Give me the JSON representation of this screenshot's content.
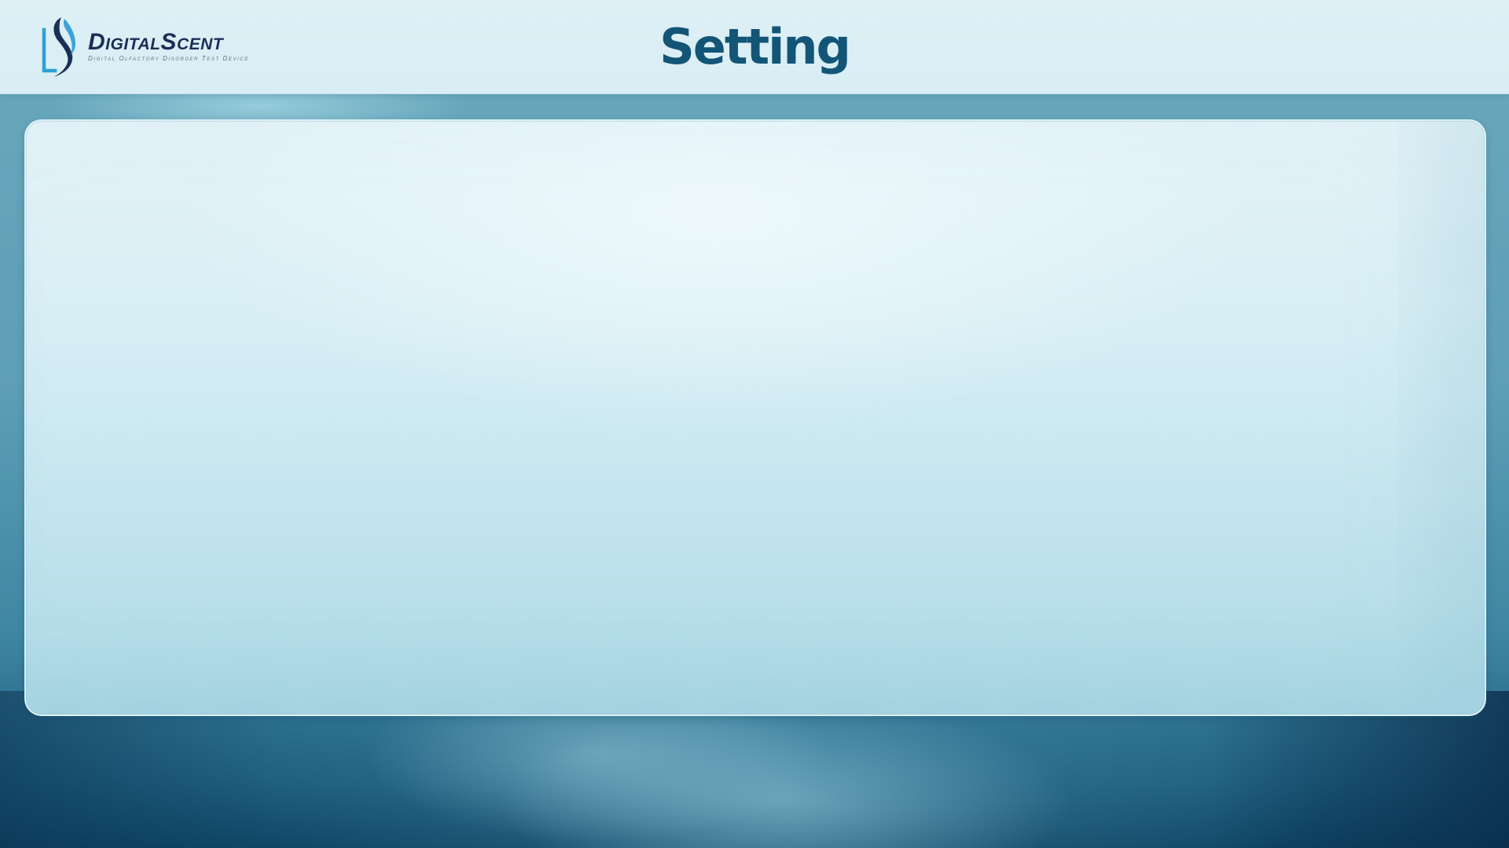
{
  "header": {
    "logo": {
      "name": "DigitalScent",
      "tagline": "Digital Olfactory Disorder Test Device"
    },
    "title": "Setting"
  },
  "main": {
    "panel": {}
  },
  "colors": {
    "title": "#135576",
    "brand_dark": "#1a2f56",
    "brand_light": "#3aa3d8",
    "header_bg": "#def0f6"
  }
}
